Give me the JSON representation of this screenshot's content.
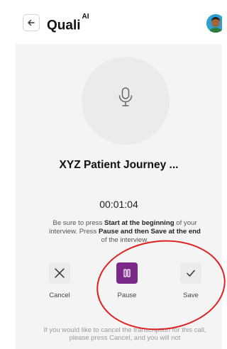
{
  "header": {
    "title": "Quali",
    "title_superscript": "AI",
    "back_icon": "arrow-left-icon",
    "avatar": "user-avatar"
  },
  "recorder": {
    "mic_icon": "microphone-icon",
    "journey_title": "XYZ Patient Journey ...",
    "timer": "00:01:04"
  },
  "instructions": {
    "t1": "Be sure to press ",
    "b1": "Start at the beginning",
    "t2": " of your interview. Press ",
    "b2": "Pause and then Save at the end",
    "t3": " of the interview."
  },
  "controls": {
    "cancel_label": "Cancel",
    "pause_label": "Pause",
    "save_label": "Save",
    "cancel_icon": "x-icon",
    "pause_icon": "pause-icon",
    "save_icon": "check-icon"
  },
  "footer": {
    "note": "If you would like to cancel the transcription for this call, please press Cancel, and you will not"
  },
  "colors": {
    "accent": "#7b2a8a",
    "annotation": "#e02020",
    "background": "#f4f4f5"
  }
}
